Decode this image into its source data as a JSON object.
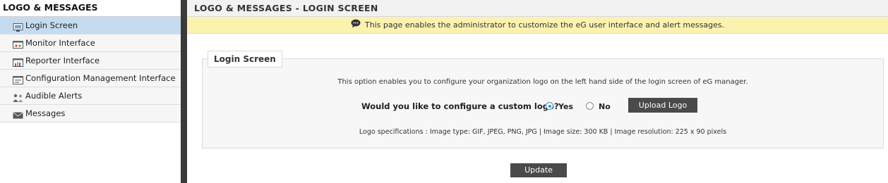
{
  "sidebar": {
    "header": "LOGO & MESSAGES",
    "items": [
      {
        "label": "Login Screen",
        "icon": "monitor-screen-icon",
        "active": true
      },
      {
        "label": "Monitor Interface",
        "icon": "monitor-interface-icon",
        "active": false
      },
      {
        "label": "Reporter Interface",
        "icon": "reporter-chart-icon",
        "active": false
      },
      {
        "label": "Configuration Management Interface",
        "icon": "configuration-window-icon",
        "active": false
      },
      {
        "label": "Audible Alerts",
        "icon": "audible-alerts-people-icon",
        "active": false
      },
      {
        "label": "Messages",
        "icon": "envelope-icon",
        "active": false
      }
    ]
  },
  "main": {
    "title": "LOGO & MESSAGES - LOGIN SCREEN",
    "notice": "This page enables the administrator to customize the eG user interface and alert messages.",
    "panel": {
      "legend": "Login Screen",
      "description": "This option enables you to configure your organization logo on the left hand side of the login screen of eG manager.",
      "question": "Would you like to configure a custom logo?",
      "option_yes": "Yes",
      "option_no": "No",
      "selected": "Yes",
      "upload_label": "Upload Logo",
      "specs": "Logo specifications : Image type: GIF, JPEG, PNG, JPG | Image size: 300 KB | Image resolution: 225 x 90 pixels"
    },
    "update_label": "Update"
  },
  "colors": {
    "active_item": "#c5dcf0",
    "notice_bg": "#fcf2b0",
    "button_bg": "#4a4a4a",
    "radio_checked": "#3a8fc8"
  }
}
